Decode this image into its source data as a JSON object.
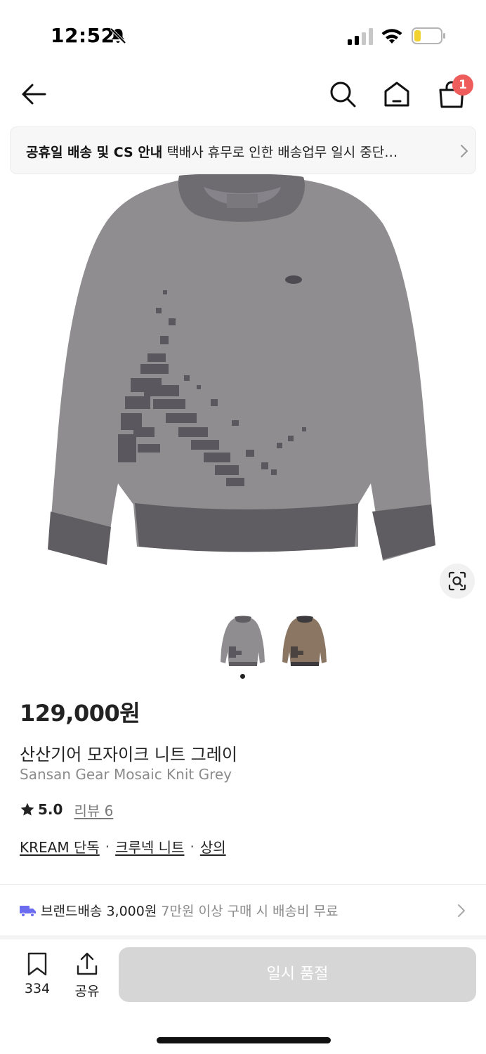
{
  "status_bar": {
    "time": "12:52",
    "icons": [
      "bell-off-icon",
      "signal-icon",
      "wifi-icon",
      "battery-icon"
    ]
  },
  "nav": {
    "icons": [
      "back-arrow-icon",
      "search-icon",
      "home-icon",
      "shopping-bag-icon"
    ],
    "cart_count": "1"
  },
  "notice": {
    "title": "공휴일 배송 및 CS 안내",
    "text": "택배사 휴무로 인한 배송업무 일시 중단…"
  },
  "product": {
    "price": "129,000원",
    "name_ko": "산산기어 모자이크 니트 그레이",
    "name_en": "Sansan Gear Mosaic Knit Grey",
    "rating": "5.0",
    "review_label": "리뷰 6",
    "tags": [
      "KREAM 단독",
      "크루넥 니트",
      "상의"
    ],
    "tag_separator": "·",
    "image_page": 1,
    "image_count": 2
  },
  "shipping": {
    "type": "브랜드배송 3,000원",
    "description": "7만원 이상 구매 시 배송비 무료"
  },
  "bottom_bar": {
    "bookmark_count": "334",
    "share_label": "공유",
    "action_button": "일시 품절"
  },
  "colors": {
    "accent_badge": "#ef5c5c",
    "truck_icon": "#6c6cf0",
    "disabled_button": "#d6d6d6"
  }
}
